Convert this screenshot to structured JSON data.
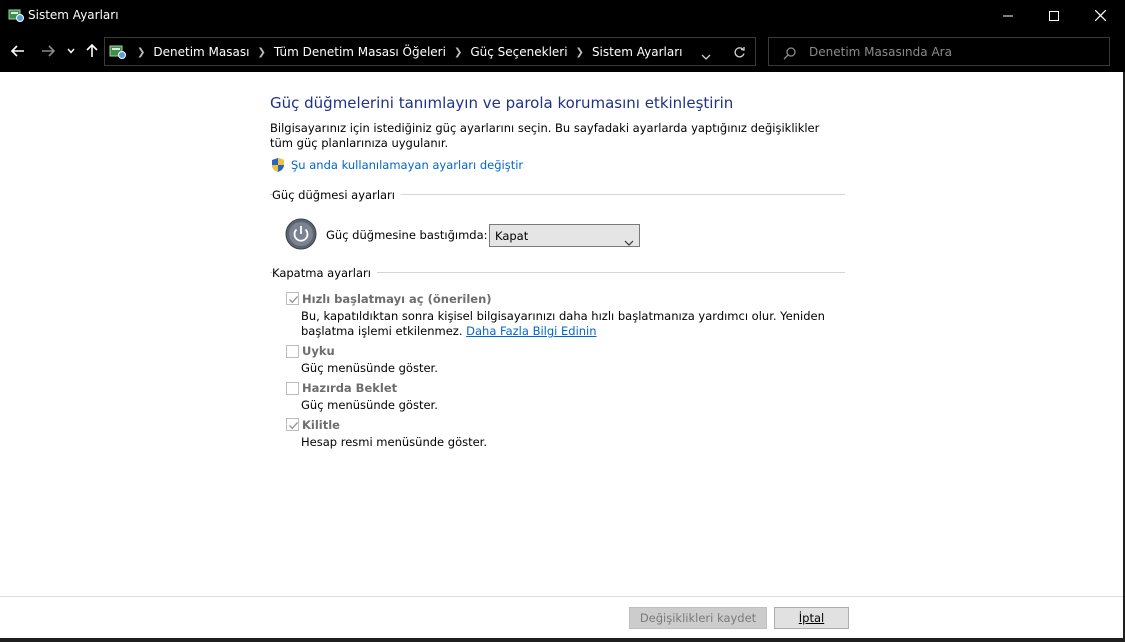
{
  "window": {
    "title": "Sistem Ayarları"
  },
  "nav": {
    "breadcrumbs": [
      "Denetim Masası",
      "Tüm Denetim Masası Öğeleri",
      "Güç Seçenekleri",
      "Sistem Ayarları"
    ],
    "search_placeholder": "Denetim Masasında Ara"
  },
  "content": {
    "heading": "Güç düğmelerini tanımlayın ve parola korumasını etkinleştirin",
    "description": "Bilgisayarınız için istediğiniz güç ayarlarını seçin. Bu sayfadaki ayarlarda yaptığınız değişiklikler tüm güç planlarınıza uygulanır.",
    "change_unavailable_link": "Şu anda kullanılamayan ayarları değiştir",
    "power_button_group": {
      "label": "Güç düğmesi ayarları",
      "power_button_label": "Güç düğmesine bastığımda:",
      "selected": "Kapat"
    },
    "shutdown_group": {
      "label": "Kapatma ayarları",
      "options": [
        {
          "label": "Hızlı başlatmayı aç (önerilen)",
          "checked": true,
          "desc": "Bu, kapatıldıktan sonra kişisel bilgisayarınızı daha hızlı başlatmanıza yardımcı olur. Yeniden başlatma işlemi etkilenmez.",
          "link": "Daha Fazla Bilgi Edinin"
        },
        {
          "label": "Uyku",
          "checked": false,
          "desc": "Güç menüsünde göster."
        },
        {
          "label": "Hazırda Beklet",
          "checked": false,
          "desc": "Güç menüsünde göster."
        },
        {
          "label": "Kilitle",
          "checked": true,
          "desc": "Hesap resmi menüsünde göster."
        }
      ]
    }
  },
  "footer": {
    "save_label": "Değişiklikleri kaydet",
    "cancel_label": "İptal"
  },
  "colors": {
    "heading": "#1e3287",
    "link": "#0066cc",
    "titlebar": "#000000"
  }
}
